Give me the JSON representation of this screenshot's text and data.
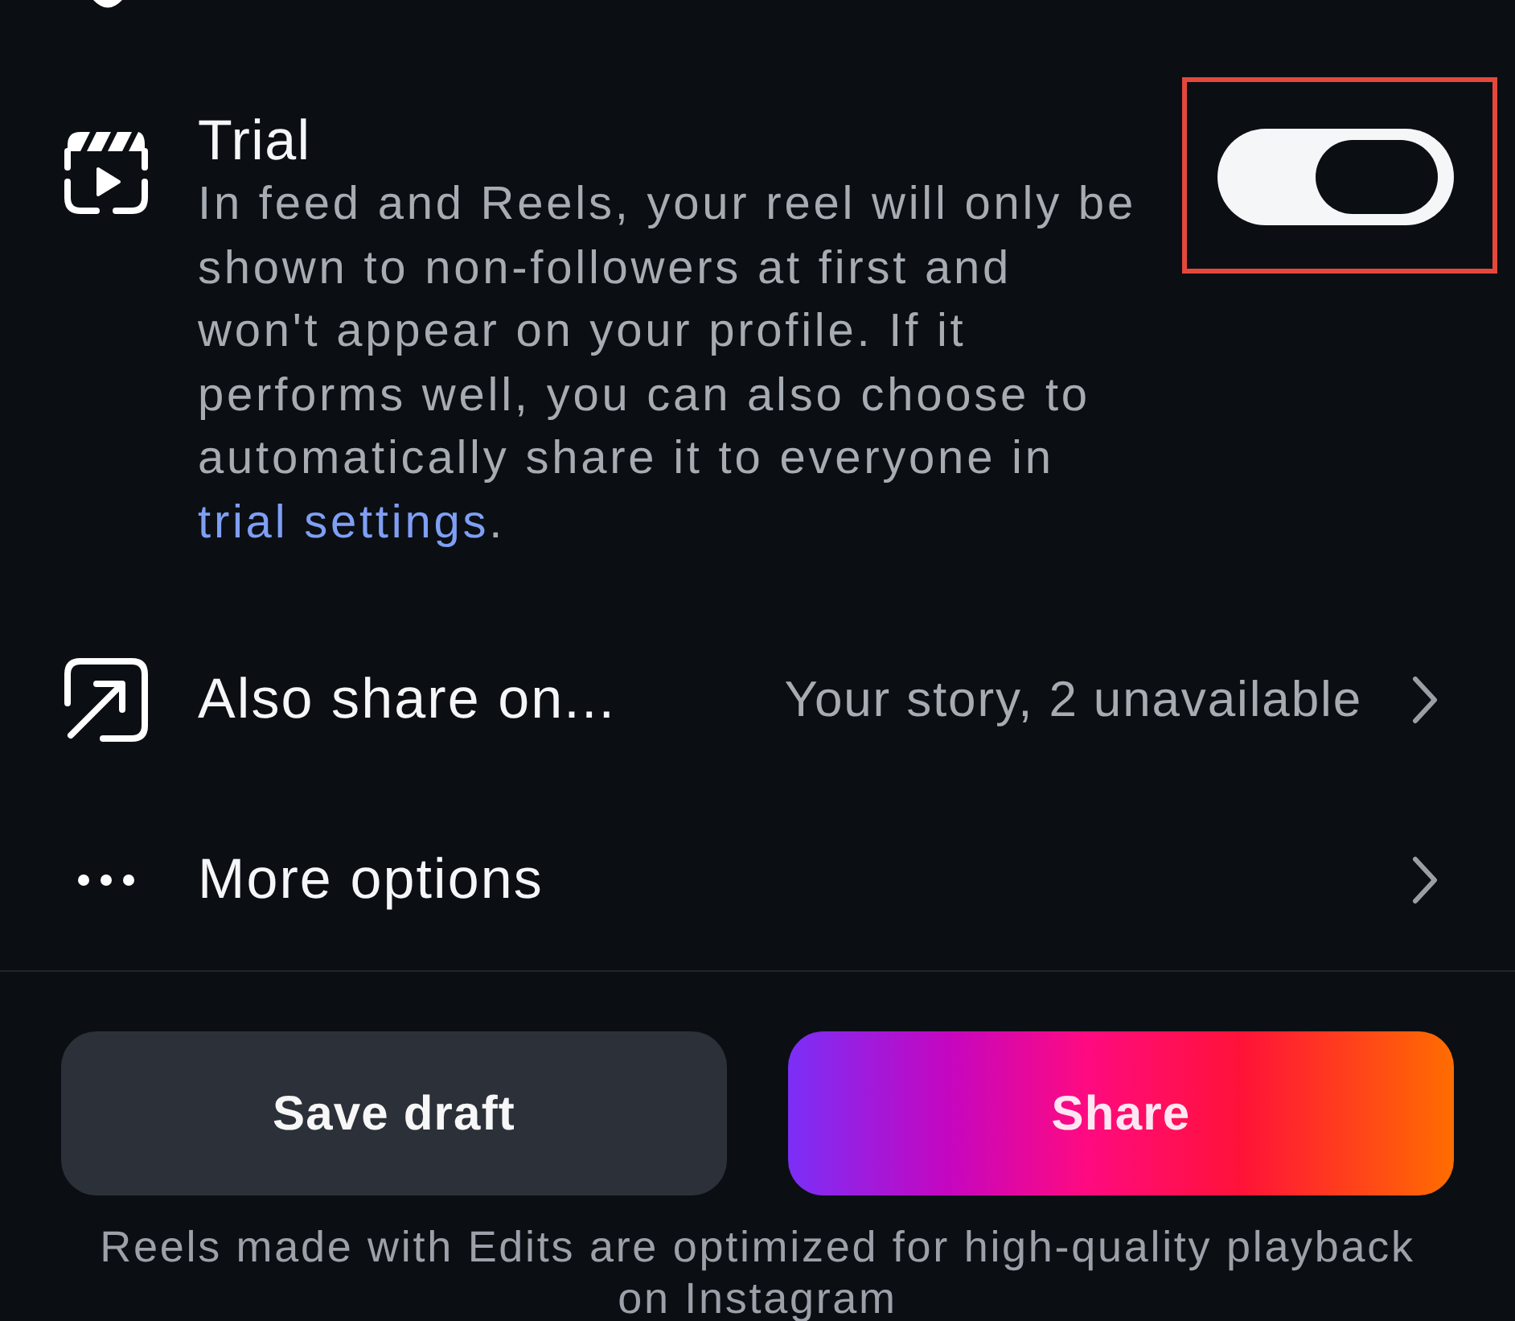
{
  "trial": {
    "title": "Trial",
    "description": "In feed and Reels, your reel will only be shown to non-followers at first and won't appear on your profile. If it performs well, you can also choose to automatically share it to everyone in",
    "link": "trial settings",
    "link_suffix": ".",
    "toggle": {
      "on": true,
      "highlighted": true
    }
  },
  "options": [
    {
      "kind": "crosspost",
      "label": "Also share on...",
      "value": "Your story, 2 unavailable"
    },
    {
      "kind": "more",
      "label": "More options"
    }
  ],
  "buttons": [
    {
      "kind": "secondary",
      "label": "Save draft"
    },
    {
      "kind": "primary",
      "label": "Share"
    }
  ],
  "footer": "Reels made with Edits are optimized for high-quality playback on Instagram"
}
